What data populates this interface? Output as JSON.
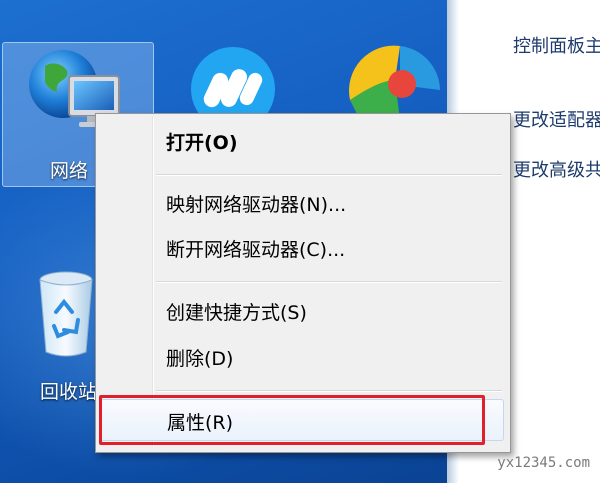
{
  "desktop": {
    "network_label": "网络",
    "recycle_label": "回收站"
  },
  "control_panel": {
    "title": "控制面板主页",
    "link1": "更改适配器设置",
    "link2": "更改高级共享设置"
  },
  "context_menu": {
    "items": [
      {
        "label": "打开(O)"
      },
      {
        "label": "映射网络驱动器(N)..."
      },
      {
        "label": "断开网络驱动器(C)..."
      },
      {
        "label": "创建快捷方式(S)"
      },
      {
        "label": "删除(D)"
      },
      {
        "label": "属性(R)"
      }
    ]
  },
  "watermark": "yx12345.com",
  "colors": {
    "desktop_blue": "#1560c2",
    "highlight_red": "#e0202a"
  }
}
